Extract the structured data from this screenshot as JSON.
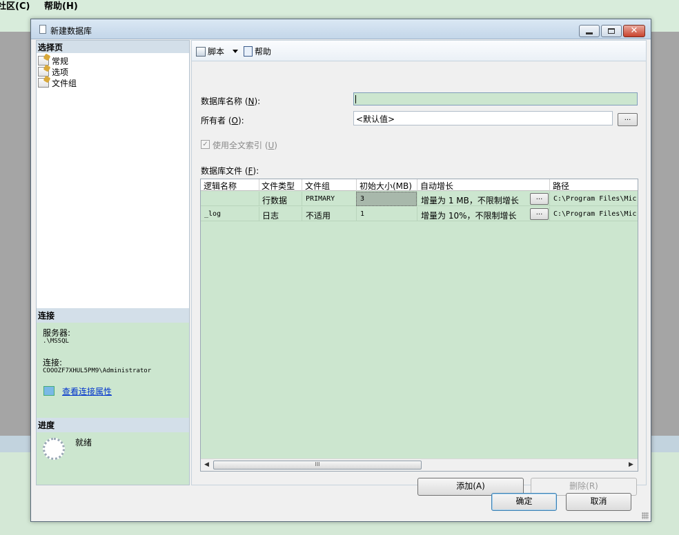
{
  "background": {
    "menu_items": [
      "社区(C)",
      "帮助(H)"
    ]
  },
  "window": {
    "title": "新建数据库"
  },
  "left_pane": {
    "select_page_header": "选择页",
    "pages": [
      {
        "label": "常规"
      },
      {
        "label": "选项"
      },
      {
        "label": "文件组"
      }
    ],
    "connection_header": "连接",
    "server_label": "服务器:",
    "server_value": ".\\MSSQL",
    "connection_label": "连接:",
    "connection_value": "COOOZF7XHUL5PM9\\Administrator",
    "view_connection_link": "查看连接属性",
    "progress_header": "进度",
    "progress_status": "就绪"
  },
  "toolbar": {
    "script_label": "脚本",
    "help_label": "帮助"
  },
  "form": {
    "db_name_label_prefix": "数据库名称 (",
    "db_name_hotkey": "N",
    "db_name_label_suffix": "):",
    "db_name_value": "",
    "owner_label_prefix": "所有者 (",
    "owner_hotkey": "O",
    "owner_label_suffix": "):",
    "owner_value": "<默认值>",
    "browse_label": "...",
    "fulltext_label_prefix": "使用全文索引 (",
    "fulltext_hotkey": "U",
    "fulltext_label_suffix": ")",
    "fulltext_checked": true,
    "db_files_label_prefix": "数据库文件 (",
    "db_files_hotkey": "F",
    "db_files_label_suffix": "):"
  },
  "files_grid": {
    "columns": [
      "逻辑名称",
      "文件类型",
      "文件组",
      "初始大小(MB)",
      "自动增长",
      "路径"
    ],
    "rows": [
      {
        "logical_name": "",
        "file_type": "行数据",
        "filegroup": "PRIMARY",
        "initial_size": "3",
        "autogrowth": "增量为 1 MB，不限制增长",
        "button": "...",
        "path": "C:\\Program Files\\Mic"
      },
      {
        "logical_name": "_log",
        "file_type": "日志",
        "filegroup": "不适用",
        "initial_size": "1",
        "autogrowth": "增量为 10%，不限制增长",
        "button": "...",
        "path": "C:\\Program Files\\Mic"
      }
    ],
    "scroll_thumb_glyph": "III"
  },
  "buttons": {
    "add": "添加(A)",
    "remove": "删除(R)",
    "ok": "确定",
    "cancel": "取消"
  }
}
